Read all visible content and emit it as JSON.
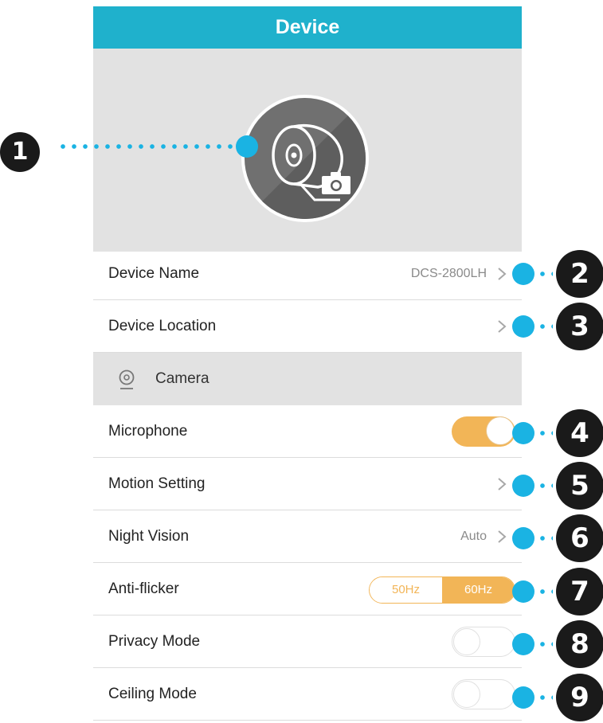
{
  "header": {
    "title": "Device"
  },
  "rows": {
    "device_name": {
      "label": "Device Name",
      "value": "DCS-2800LH"
    },
    "device_location": {
      "label": "Device Location"
    },
    "section_camera": {
      "label": "Camera"
    },
    "microphone": {
      "label": "Microphone",
      "state": "on"
    },
    "motion_setting": {
      "label": "Motion Setting"
    },
    "night_vision": {
      "label": "Night Vision",
      "value": "Auto"
    },
    "anti_flicker": {
      "label": "Anti-flicker",
      "options": [
        "50Hz",
        "60Hz"
      ],
      "selected": "60Hz"
    },
    "privacy_mode": {
      "label": "Privacy Mode",
      "state": "off"
    },
    "ceiling_mode": {
      "label": "Ceiling Mode",
      "state": "off"
    }
  },
  "callouts": [
    "1",
    "2",
    "3",
    "4",
    "5",
    "6",
    "7",
    "8",
    "9"
  ],
  "colors": {
    "header": "#1fb1cc",
    "accent": "#f2b557",
    "callout_dot": "#1ab3e3",
    "badge": "#1a1a1a"
  }
}
